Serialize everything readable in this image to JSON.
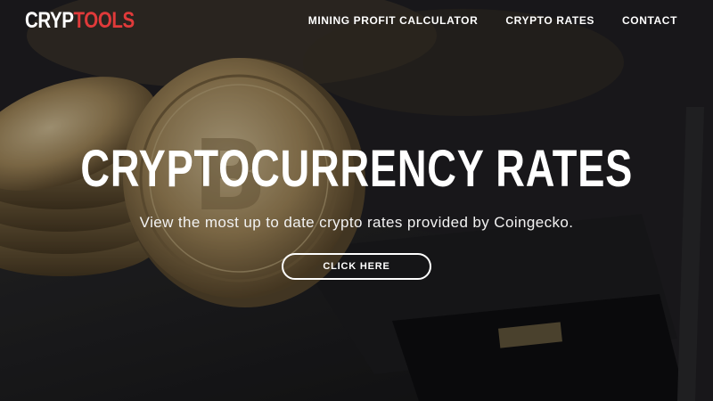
{
  "brand": {
    "logo_part1": "CRYP",
    "logo_part2": "TOOLS",
    "accent_color": "#e03a3a"
  },
  "nav": {
    "items": [
      {
        "label": "MINING PROFIT CALCULATOR"
      },
      {
        "label": "CRYPTO RATES"
      },
      {
        "label": "CONTACT"
      }
    ]
  },
  "hero": {
    "title": "CRYPTOCURRENCY RATES",
    "subtitle": "View the most up to date crypto rates provided by Coingecko.",
    "cta_label": "CLICK HERE",
    "background_image": "bitcoin-coins-photo"
  }
}
